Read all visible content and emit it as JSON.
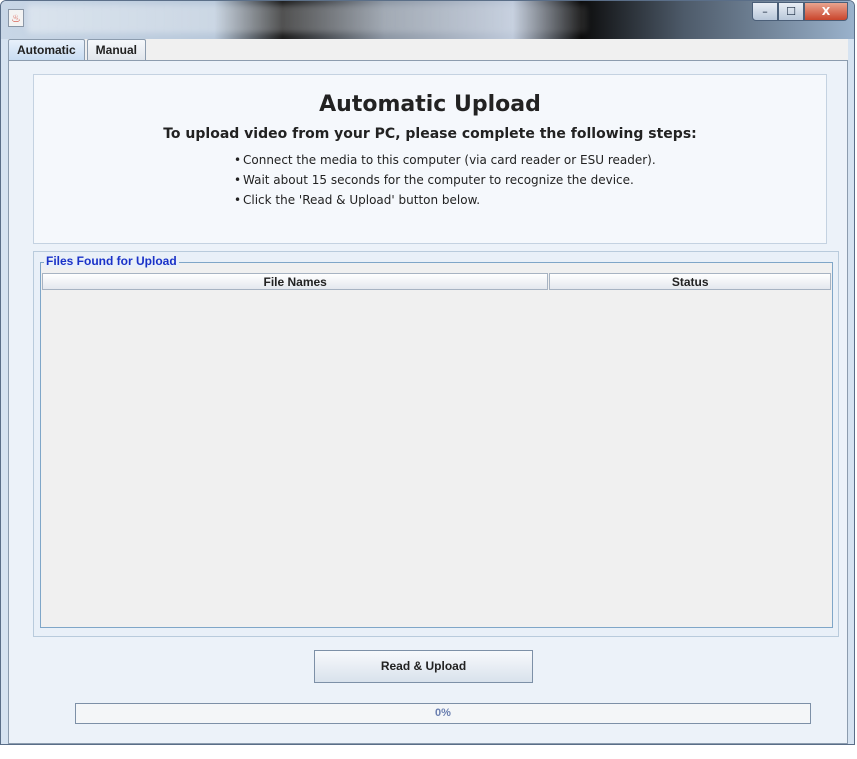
{
  "window": {
    "controls": {
      "minimize": "–",
      "maximize": "☐",
      "close": "X"
    }
  },
  "tabs": [
    {
      "label": "Automatic",
      "active": true
    },
    {
      "label": "Manual",
      "active": false
    }
  ],
  "instructions": {
    "title": "Automatic Upload",
    "subtitle": "To upload video from your PC, please complete the following steps:",
    "steps": [
      "Connect the media to this computer (via card reader or ESU reader).",
      "Wait about 15 seconds for the computer to recognize the device.",
      "Click the 'Read & Upload' button below."
    ]
  },
  "files": {
    "group_label": "Files Found for Upload",
    "columns": [
      "File Names",
      "Status"
    ],
    "rows": []
  },
  "actions": {
    "upload_label": "Read & Upload"
  },
  "progress": {
    "value": 0,
    "label": "0%"
  },
  "colors": {
    "legend_text": "#1a32c8",
    "progress_text": "#6a7fb0"
  }
}
